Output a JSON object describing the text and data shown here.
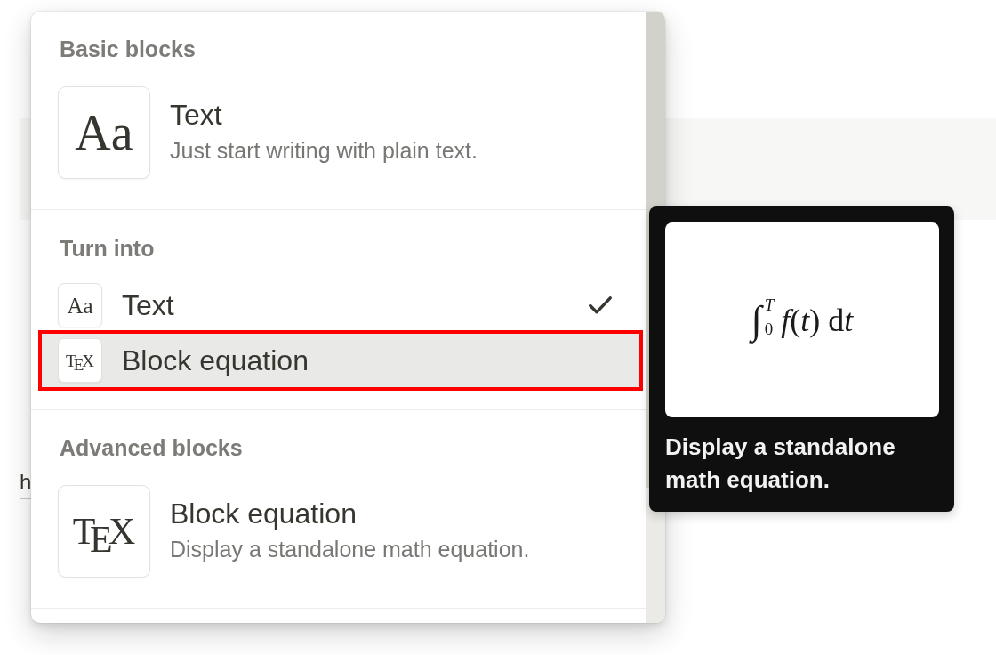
{
  "page": {
    "text_fragment": "h"
  },
  "menu": {
    "sections": [
      {
        "heading": "Basic blocks",
        "kind": "cards",
        "items": [
          {
            "icon": "Aa",
            "kind": "letters",
            "title": "Text",
            "description": "Just start writing with plain text."
          }
        ]
      },
      {
        "heading": "Turn into",
        "kind": "rows",
        "items": [
          {
            "icon": "Aa",
            "kind": "letters",
            "label": "Text",
            "checked": true,
            "selected": false,
            "outlined": false
          },
          {
            "icon": "T$_{E}$X",
            "kind": "logo",
            "label": "Block equation",
            "checked": false,
            "selected": true,
            "outlined": true
          }
        ]
      },
      {
        "heading": "Advanced blocks",
        "kind": "cards",
        "items": [
          {
            "icon": "T$_{E}$X",
            "kind": "logo",
            "title": "Block equation",
            "description": "Display a standalone math equation."
          }
        ]
      }
    ]
  },
  "tooltip": {
    "preview": {
      "symbol": "∫",
      "upper": "T",
      "lower": "0",
      "body": "*f*(*t*)",
      "differential": "d",
      "variable": "t"
    },
    "text": "Display a standalone math equation."
  }
}
